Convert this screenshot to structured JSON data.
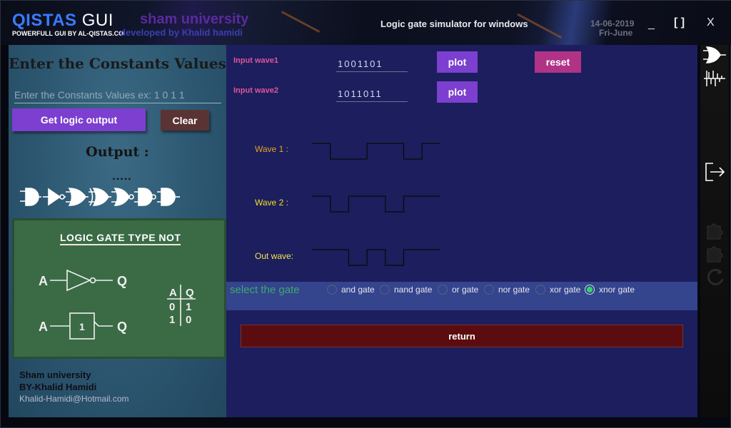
{
  "titlebar": {
    "brand": "QISTAS",
    "brand_suffix": "GUI",
    "brand_tagline": "POWERFULL GUI BY AL-QISTAS.CO",
    "university": "sham university",
    "developer": "developed by Khalid hamidi",
    "app_title": "Logic gate simulator for windows",
    "date": "14-06-2019",
    "day": "Fri-June",
    "minimize_glyph": "_",
    "maximize_glyph": "[ ]",
    "close_glyph": "X"
  },
  "left": {
    "title": "Enter the Constants Values",
    "input_placeholder": "Enter the Constants Values ex: 1 0 1 1",
    "get_output_label": "Get logic output",
    "clear_label": "Clear",
    "output_label": "Output :",
    "output_value": ".....",
    "gate_icons": [
      "and-gate",
      "not-gate",
      "or-gate",
      "xor-gate",
      "nor-gate",
      "nand-gate",
      "xnor-gate"
    ],
    "chalkboard": {
      "title": "LOGIC GATE TYPE NOT",
      "input_letter": "A",
      "output_letter": "Q",
      "box_label": "1",
      "table_headers": [
        "A",
        "Q"
      ],
      "table_rows": [
        [
          "0",
          "1"
        ],
        [
          "1",
          "0"
        ]
      ]
    },
    "footer": {
      "university": "Sham university",
      "author": "BY-Khalid Hamidi",
      "email": "Khalid-Hamidi@Hotmail.com"
    }
  },
  "main": {
    "input_wave1_label": "Input wave1",
    "input_wave1_value": "1001101",
    "input_wave2_label": "Input wave2",
    "input_wave2_value": "1011011",
    "plot_label": "plot",
    "reset_label": "reset",
    "wave1_label": "Wave 1 :",
    "wave2_label": "Wave 2 :",
    "out_label": "Out wave:",
    "waves": {
      "wave1": [
        1,
        0,
        0,
        1,
        1,
        0,
        1
      ],
      "wave2": [
        1,
        0,
        1,
        1,
        0,
        1,
        1
      ],
      "out": [
        1,
        1,
        0,
        1,
        0,
        1,
        1
      ]
    },
    "gate_prompt": "select the gate",
    "gates": [
      {
        "label": "and gate",
        "selected": false
      },
      {
        "label": "nand gate",
        "selected": false
      },
      {
        "label": "or gate",
        "selected": false
      },
      {
        "label": "nor gate",
        "selected": false
      },
      {
        "label": "xor gate",
        "selected": false
      },
      {
        "label": "xnor gate",
        "selected": true
      }
    ],
    "return_label": "return"
  },
  "right_strip": {
    "icons": [
      "gate-tool-icon",
      "waveform-icon",
      "logout-icon",
      "puzzle-icon",
      "puzzle-icon",
      "refresh-icon"
    ]
  },
  "colors": {
    "main_bg": "#1c1e5e",
    "left_bg": "#2c5670",
    "accent_purple": "#7c3fd0",
    "reset_pink": "#b03386",
    "return_red": "#5a0c0e",
    "wave1_label": "#e8a020",
    "wave2_label": "#f0e020",
    "out_label": "#f2e64a",
    "selected_radio": "#35d273"
  }
}
